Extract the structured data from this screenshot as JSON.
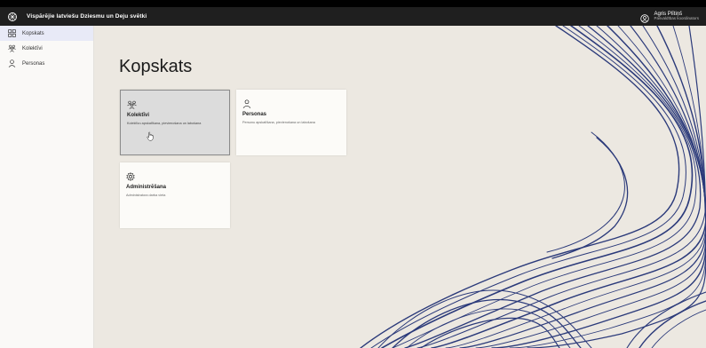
{
  "header": {
    "app_title": "Vispārējie latviešu Dziesmu un Deju svētki",
    "user_name": "Agris Plītiņš",
    "user_role": "Pasvaldības koordinators"
  },
  "sidebar": {
    "items": [
      {
        "label": "Kopskats",
        "icon": "dashboard-icon",
        "active": true
      },
      {
        "label": "Kolektīvi",
        "icon": "group-icon",
        "active": false
      },
      {
        "label": "Personas",
        "icon": "person-icon",
        "active": false
      }
    ]
  },
  "main": {
    "title": "Kopskats",
    "cards": [
      {
        "title": "Kolektīvi",
        "description": "Kolektīvu apskatīšana, pievienošana un labošana",
        "icon": "group-icon"
      },
      {
        "title": "Personas",
        "description": "Personu apskatīšana, pievienošana un labošana",
        "icon": "person-icon"
      },
      {
        "title": "Administrēšana",
        "description": "Administratora darba vieta",
        "icon": "gear-icon"
      }
    ]
  },
  "colors": {
    "topbar": "#1f1f1f",
    "background": "#ece8e1",
    "card": "#fcfbf8",
    "art_stroke": "#2b3a7a"
  }
}
